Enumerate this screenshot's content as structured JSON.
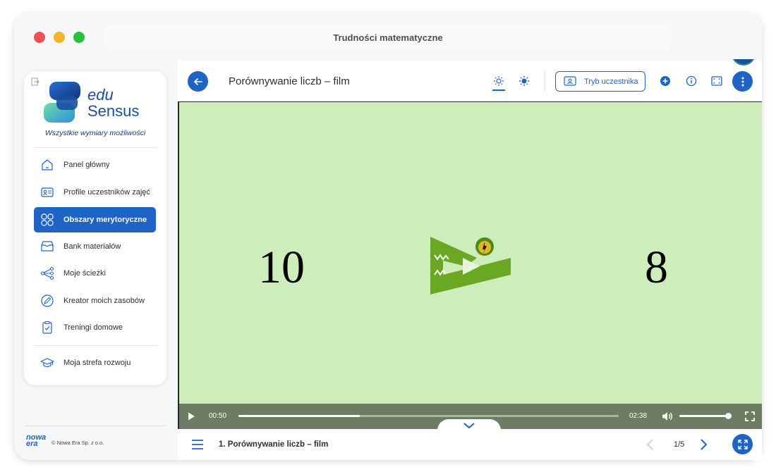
{
  "window": {
    "title": "Trudności matematyczne"
  },
  "sidebar": {
    "logo": {
      "edu": "edu",
      "sensus": "Sensus",
      "tagline": "Wszystkie wymiary możliwości"
    },
    "items": [
      {
        "label": "Panel główny",
        "icon": "home-icon"
      },
      {
        "label": "Profile uczestników zajęć",
        "icon": "id-card-icon"
      },
      {
        "label": "Obszary merytoryczne",
        "icon": "grid-icon",
        "active": true
      },
      {
        "label": "Bank materiałów",
        "icon": "archive-icon"
      },
      {
        "label": "Moje ścieżki",
        "icon": "share-paths-icon"
      },
      {
        "label": "Kreator moich zasobów",
        "icon": "pencil-circle-icon"
      },
      {
        "label": "Treningi domowe",
        "icon": "clipboard-check-icon"
      },
      {
        "label": "Moja strefa rozwoju",
        "icon": "graduation-cap-icon"
      }
    ],
    "footer": {
      "brand_line1": "nowa",
      "brand_line2": "era",
      "copyright": "© Nowa Era Sp. z o.o."
    }
  },
  "header": {
    "title": "Porównywanie liczb – film",
    "student_mode_label": "Tryb uczestnika"
  },
  "video": {
    "left_number": "10",
    "right_number": "8",
    "current_time": "00:50",
    "duration": "02:38",
    "progress_fraction": 0.32,
    "volume_fraction": 0.98
  },
  "bottom": {
    "lesson_title": "1. Porównywanie liczb – film",
    "page_counter": "1/5"
  },
  "colors": {
    "accent": "#1f64c4",
    "video_bg": "#cdedbb",
    "controls_bg": "#6c7d64",
    "croc": "#6aa823"
  }
}
